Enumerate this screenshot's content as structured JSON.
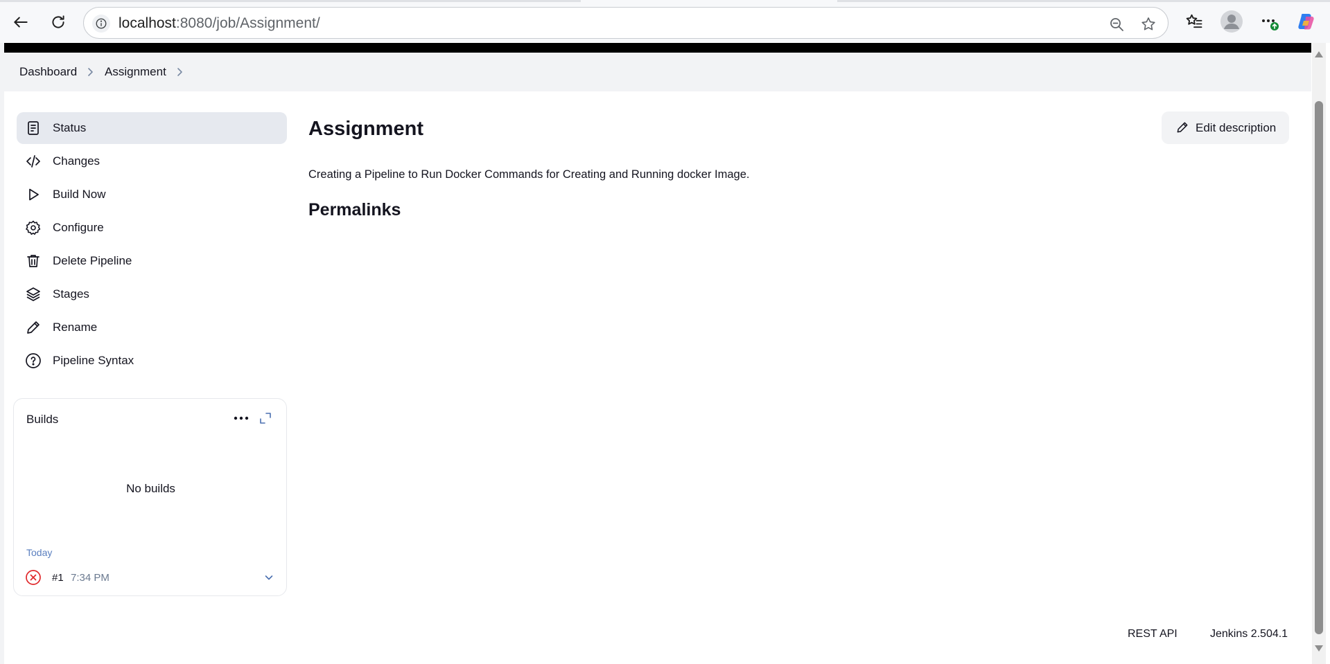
{
  "browser": {
    "url_host": "localhost",
    "url_rest": ":8080/job/Assignment/"
  },
  "breadcrumb": {
    "items": [
      "Dashboard",
      "Assignment"
    ]
  },
  "sidebar": {
    "items": [
      {
        "label": "Status",
        "icon": "document-icon",
        "active": true
      },
      {
        "label": "Changes",
        "icon": "code-icon"
      },
      {
        "label": "Build Now",
        "icon": "play-icon"
      },
      {
        "label": "Configure",
        "icon": "gear-icon"
      },
      {
        "label": "Delete Pipeline",
        "icon": "trash-icon"
      },
      {
        "label": "Stages",
        "icon": "layers-icon"
      },
      {
        "label": "Rename",
        "icon": "pencil-icon"
      },
      {
        "label": "Pipeline Syntax",
        "icon": "help-circle-icon"
      }
    ]
  },
  "builds": {
    "title": "Builds",
    "empty_text": "No builds",
    "group_label": "Today",
    "entries": [
      {
        "number": "#1",
        "time": "7:34 PM",
        "status": "failed"
      }
    ]
  },
  "main": {
    "title": "Assignment",
    "edit_label": "Edit description",
    "description": "Creating a Pipeline to Run Docker Commands for Creating and Running docker Image.",
    "permalinks_title": "Permalinks"
  },
  "footer": {
    "rest_api": "REST API",
    "version": "Jenkins 2.504.1"
  },
  "colors": {
    "accent": "#14141f",
    "active_bg": "#e6e9ef",
    "failed": "#e0272a",
    "muted_link": "#5a7fbf"
  }
}
